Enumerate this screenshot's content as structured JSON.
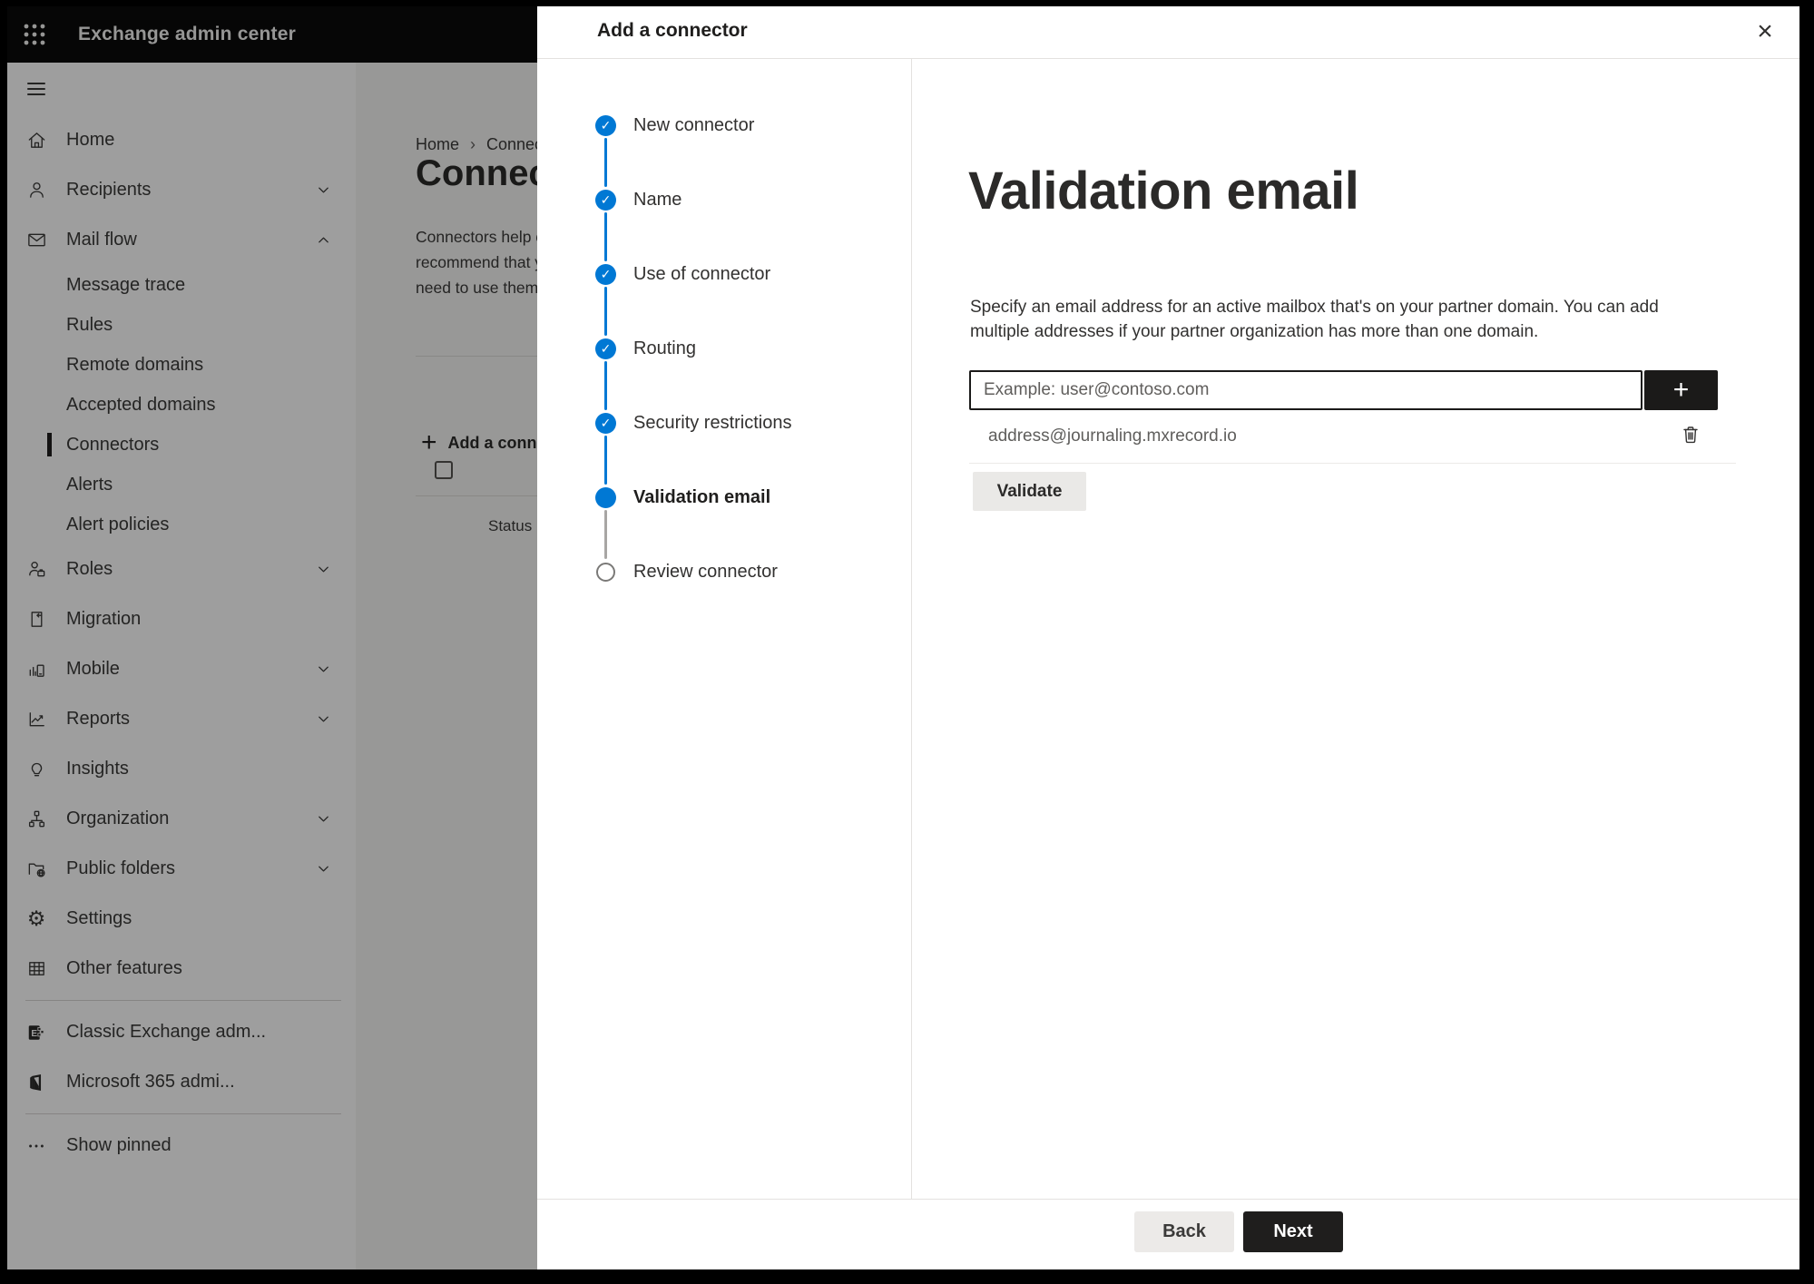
{
  "topbar": {
    "app_title": "Exchange admin center"
  },
  "sidebar": {
    "items": [
      {
        "label": "Home",
        "icon": "home-icon"
      },
      {
        "label": "Recipients",
        "icon": "person-icon",
        "chevron": "down"
      },
      {
        "label": "Mail flow",
        "icon": "mail-icon",
        "chevron": "up",
        "expanded": true
      },
      {
        "label": "Message trace",
        "sub": true
      },
      {
        "label": "Rules",
        "sub": true
      },
      {
        "label": "Remote domains",
        "sub": true
      },
      {
        "label": "Accepted domains",
        "sub": true
      },
      {
        "label": "Connectors",
        "sub": true,
        "selected": true
      },
      {
        "label": "Alerts",
        "sub": true
      },
      {
        "label": "Alert policies",
        "sub": true
      },
      {
        "label": "Roles",
        "icon": "roles-icon",
        "chevron": "down"
      },
      {
        "label": "Migration",
        "icon": "migration-icon"
      },
      {
        "label": "Mobile",
        "icon": "mobile-icon",
        "chevron": "down"
      },
      {
        "label": "Reports",
        "icon": "reports-icon",
        "chevron": "down"
      },
      {
        "label": "Insights",
        "icon": "lightbulb-icon"
      },
      {
        "label": "Organization",
        "icon": "org-icon",
        "chevron": "down"
      },
      {
        "label": "Public folders",
        "icon": "public-folder-icon",
        "chevron": "down"
      },
      {
        "label": "Settings",
        "icon": "gear-icon"
      },
      {
        "label": "Other features",
        "icon": "grid-icon"
      },
      {
        "label": "Classic Exchange adm...",
        "icon": "exchange-logo-icon"
      },
      {
        "label": "Microsoft 365 admi...",
        "icon": "office-logo-icon"
      },
      {
        "label": "Show pinned",
        "icon": "ellipsis-icon"
      }
    ]
  },
  "page": {
    "breadcrumb": {
      "home": "Home",
      "separator": "›",
      "current": "Connectors"
    },
    "title": "Connectors",
    "description_lines": [
      "Connectors help control the flow of email messages to and from your",
      "recommend that you check to see if you should create a connector, since",
      "need to use them, this is where you create and manage them."
    ],
    "add_button_label": "Add a connector",
    "add_button_plus": "+",
    "table_header_status": "Status"
  },
  "panel": {
    "title": "Add a connector",
    "close_glyph": "×",
    "steps": [
      {
        "label": "New connector",
        "state": "completed"
      },
      {
        "label": "Name",
        "state": "completed"
      },
      {
        "label": "Use of connector",
        "state": "completed"
      },
      {
        "label": "Routing",
        "state": "completed"
      },
      {
        "label": "Security restrictions",
        "state": "completed"
      },
      {
        "label": "Validation email",
        "state": "current"
      },
      {
        "label": "Review connector",
        "state": "upcoming"
      }
    ],
    "check_glyph": "✓",
    "content": {
      "heading": "Validation email",
      "description_lines": [
        "Specify an email address for an active mailbox that's on your partner domain. You can add",
        "multiple addresses if your partner organization has more than one domain."
      ],
      "email_placeholder": "Example: user@contoso.com",
      "add_email_glyph": "+",
      "addresses": [
        {
          "email": "address@journaling.mxrecord.io"
        }
      ],
      "validate_label": "Validate"
    },
    "footer": {
      "back_label": "Back",
      "next_label": "Next"
    }
  },
  "colors": {
    "accent_blue": "#0078d4",
    "dark_button": "#1b1a19",
    "panel_bg": "#ffffff",
    "topbar_bg": "#0b0b0b",
    "overlay": "rgba(0,0,0,0.38)"
  }
}
